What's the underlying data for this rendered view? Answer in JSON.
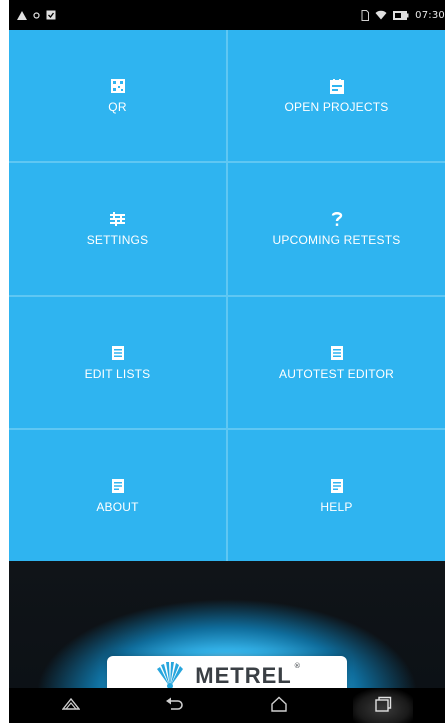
{
  "status_bar": {
    "time": "07:30",
    "left_icons": [
      "warning-icon",
      "notification-dot-icon",
      "app-notification-icon"
    ],
    "right_icons": [
      "sim-icon",
      "wifi-icon",
      "battery-icon"
    ]
  },
  "tiles": [
    {
      "label": "QR",
      "icon": "qr-code-icon"
    },
    {
      "label": "OPEN PROJECTS",
      "icon": "folder-projects-icon"
    },
    {
      "label": "SETTINGS",
      "icon": "settings-sliders-icon"
    },
    {
      "label": "UPCOMING RETESTS",
      "icon": "question-mark-icon"
    },
    {
      "label": "EDIT LISTS",
      "icon": "list-document-icon"
    },
    {
      "label": "AUTOTEST EDITOR",
      "icon": "autotest-document-icon"
    },
    {
      "label": "ABOUT",
      "icon": "info-document-icon"
    },
    {
      "label": "HELP",
      "icon": "help-document-icon"
    }
  ],
  "brand": {
    "name": "METREL",
    "registered": "®"
  },
  "nav_bar": {
    "buttons": [
      "menu-icon",
      "back-icon",
      "home-icon",
      "recent-apps-icon"
    ]
  },
  "colors": {
    "tile_background": "#2fb4f0",
    "tile_divider": "#5fc7f3",
    "status_bar": "#000000",
    "nav_bar": "#000000",
    "logo_text": "#3a3f44"
  }
}
